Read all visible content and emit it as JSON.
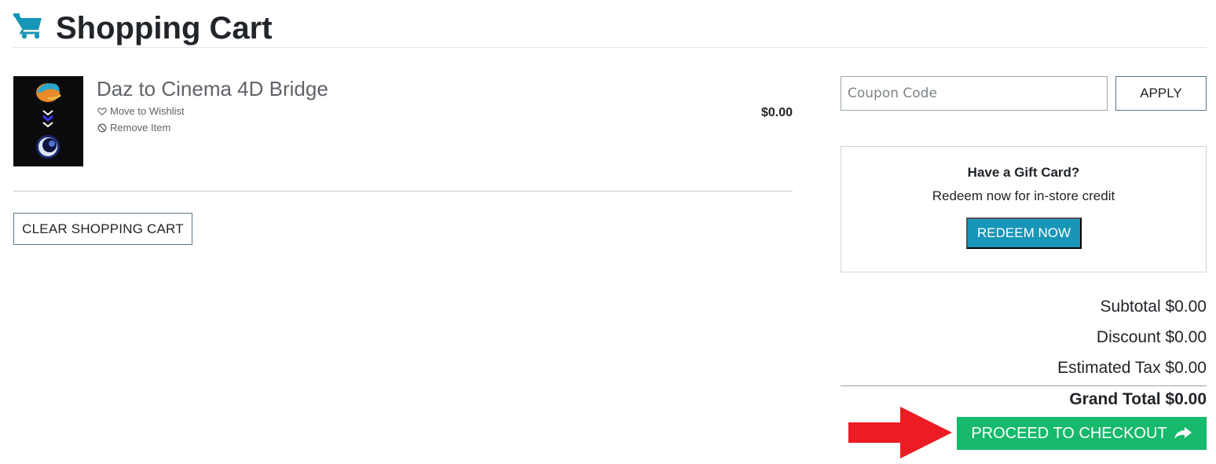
{
  "header": {
    "title": "Shopping Cart",
    "icon": "shopping-cart-icon",
    "icon_color": "#1796b8"
  },
  "cart": {
    "items": [
      {
        "name": "Daz to Cinema 4D Bridge",
        "price": "$0.00",
        "move_to_wishlist_label": "Move to Wishlist",
        "remove_label": "Remove Item"
      }
    ],
    "clear_label": "CLEAR SHOPPING CART"
  },
  "coupon": {
    "placeholder": "Coupon Code",
    "value": "",
    "apply_label": "APPLY"
  },
  "gift_card": {
    "title": "Have a Gift Card?",
    "subtitle": "Redeem now for in-store credit",
    "button_label": "REDEEM NOW",
    "button_color": "#1796b8"
  },
  "totals": {
    "subtotal": "Subtotal $0.00",
    "discount": "Discount $0.00",
    "tax": "Estimated Tax $0.00",
    "grand_total": "Grand Total $0.00"
  },
  "checkout": {
    "label": "PROCEED TO CHECKOUT",
    "button_color": "#17b96c",
    "annotation_arrow_color": "#ed1c24"
  }
}
